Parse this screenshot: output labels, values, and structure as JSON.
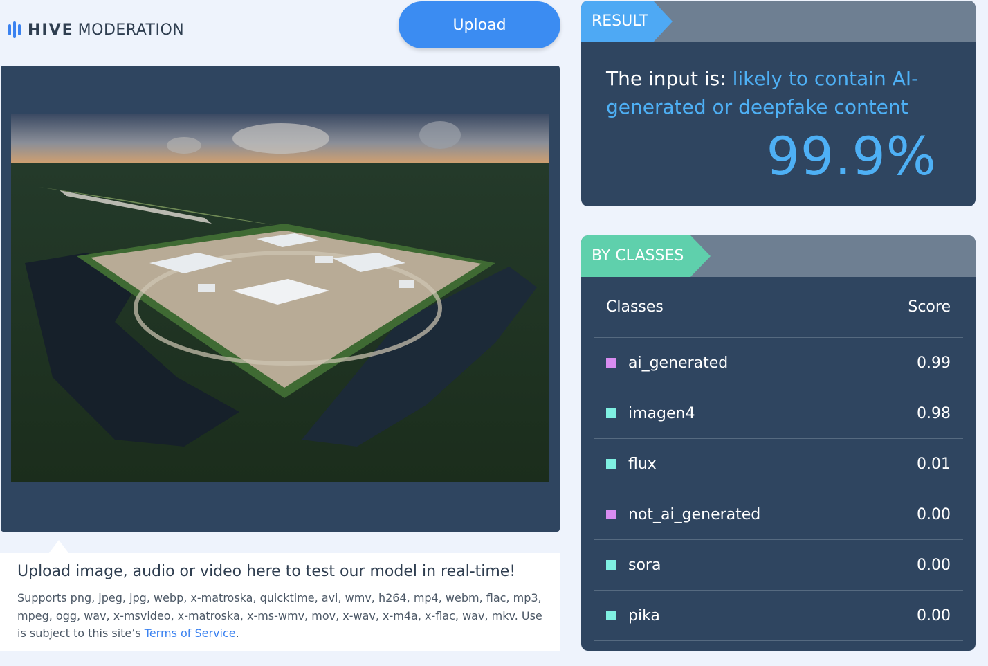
{
  "brand": {
    "name_bold": "HIVE",
    "name_light": "MODERATION",
    "color": "#3b82f0"
  },
  "upload_button": {
    "label": "Upload"
  },
  "info": {
    "title": "Upload image, audio or video here to test our model in real-time!",
    "description": "Supports png, jpeg, jpg, webp, x-matroska, quicktime, avi, wmv, h264, mp4, webm, flac, mp3, mpeg, ogg, wav, x-msvideo, x-matroska, x-ms-wmv, mov, x-wav, x-m4a, x-flac, wav, mkv. Use is subject to this site’s ",
    "tos_link": "Terms of Service",
    "tail": "."
  },
  "result": {
    "tag": "RESULT",
    "prefix": "The input is: ",
    "verdict": "likely to contain AI-generated or deepfake content",
    "score": "99.9%",
    "accent": "#4eb0f5"
  },
  "classes": {
    "tag": "BY CLASSES",
    "header_class": "Classes",
    "header_score": "Score",
    "rows": [
      {
        "name": "ai_generated",
        "score": "0.99",
        "color": "#d88cf0"
      },
      {
        "name": "imagen4",
        "score": "0.98",
        "color": "#7ff0e2"
      },
      {
        "name": "flux",
        "score": "0.01",
        "color": "#7ff0e2"
      },
      {
        "name": "not_ai_generated",
        "score": "0.00",
        "color": "#d88cf0"
      },
      {
        "name": "sora",
        "score": "0.00",
        "color": "#7ff0e2"
      },
      {
        "name": "pika",
        "score": "0.00",
        "color": "#7ff0e2"
      }
    ]
  }
}
